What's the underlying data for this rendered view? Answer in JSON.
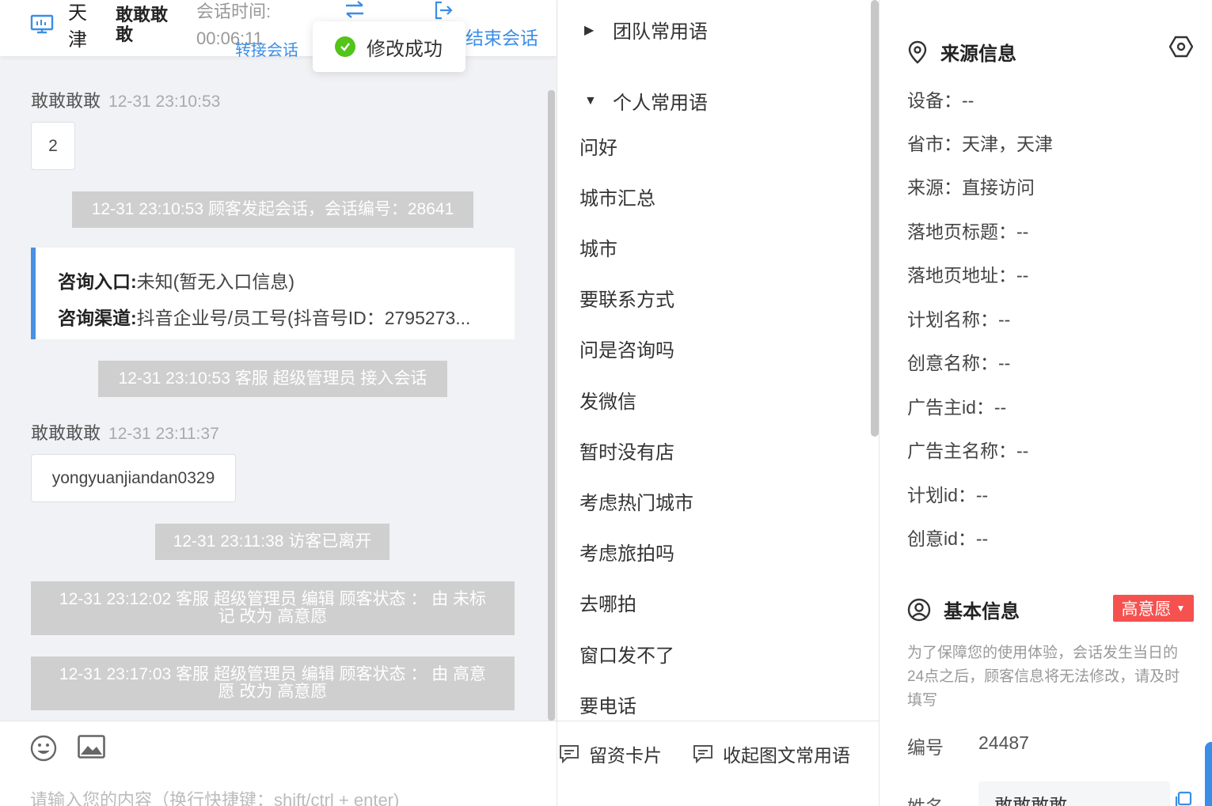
{
  "header": {
    "city": "天津",
    "visitor_name": "敢敢敢敢",
    "time_label": "会话时间:",
    "time_value": "00:06:11",
    "transfer_label": "转接会话",
    "exit_label": "结束会话"
  },
  "toast": {
    "text": "修改成功"
  },
  "chat": {
    "messages": [
      {
        "sender": "敢敢敢敢",
        "time": "12-31 23:10:53",
        "text": "2"
      },
      {
        "sender": "敢敢敢敢",
        "time": "12-31 23:11:37",
        "text": "yongyuanjiandan0329"
      }
    ],
    "system": [
      "12-31 23:10:53 顾客发起会话，会话编号：28641",
      "12-31 23:10:53 客服 超级管理员 接入会话",
      "12-31 23:11:38 访客已离开",
      "12-31 23:12:02 客服 超级管理员 编辑 顾客状态 ： 由 未标记 改为 高意愿",
      "12-31 23:17:03 客服 超级管理员 编辑 顾客状态 ： 由 高意愿 改为 高意愿"
    ],
    "entry_card": {
      "entry_label": "咨询入口:",
      "entry_value": "未知(暂无入口信息)",
      "channel_label": "咨询渠道:",
      "channel_value": "抖音企业号/员工号(抖音号ID：2795273..."
    },
    "input_placeholder": "请输入您的内容（换行快捷键：shift/ctrl + enter)"
  },
  "phrases": {
    "team_group": "团队常用语",
    "personal_group": "个人常用语",
    "items": [
      "问好",
      "城市汇总",
      "城市",
      "要联系方式",
      "问是咨询吗",
      "发微信",
      "暂时没有店",
      "考虑热门城市",
      "考虑旅拍吗",
      "去哪拍",
      "窗口发不了",
      "要电话"
    ],
    "card_button": "留资卡片",
    "collapse_button": "收起图文常用语"
  },
  "info": {
    "source_title": "来源信息",
    "source_rows": [
      "设备：--",
      "省市：天津，天津",
      "来源：直接访问",
      "落地页标题：--",
      "落地页地址：--",
      "计划名称：--",
      "创意名称：--",
      "广告主id：--",
      "广告主名称：--",
      "计划id：--",
      "创意id：--"
    ],
    "basic_title": "基本信息",
    "intent_badge": "高意愿",
    "notice": "为了保障您的使用体验，会话发生当日的24点之后，顾客信息将无法修改，请及时填写",
    "id_label": "编号",
    "id_value": "24487",
    "name_label": "姓名",
    "name_value": "敢敢敢敢"
  },
  "colors": {
    "accent": "#3a8ee6",
    "badge": "#f5514f",
    "success": "#52c41a",
    "system_bg": "#cfcfcf"
  }
}
